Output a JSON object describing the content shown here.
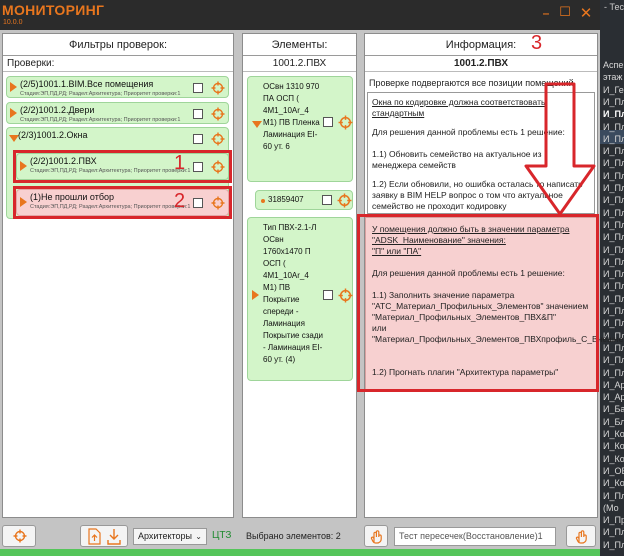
{
  "window": {
    "title": "МОНИТОРИНГ",
    "version": "10.0.0",
    "minimize_glyph": "–",
    "maximize_glyph": "☐",
    "close_glyph": "✕"
  },
  "colors": {
    "accent": "#e8761e",
    "ok": "#d3f5c9",
    "error": "#f8d0d0",
    "annotation": "#d8262b",
    "status": "#55c55a"
  },
  "bg_editor": {
    "tab_text": "- Тест",
    "rows": [
      {
        "text": "Аспект",
        "bold": false
      },
      {
        "text": "этаж",
        "bold": false
      },
      {
        "text": "И_Ген",
        "bold": false
      },
      {
        "text": "И_Пл",
        "bold": false
      },
      {
        "text": "И_Пл",
        "bold": true
      },
      {
        "text": "И_Пл",
        "bold": false
      },
      {
        "text": "И_Пл",
        "bold": false
      },
      {
        "text": "И_Пл",
        "bold": false
      },
      {
        "text": "И_Пл",
        "bold": false
      },
      {
        "text": "И_Пл",
        "bold": false
      },
      {
        "text": "И_Пл",
        "bold": false
      },
      {
        "text": "И_Пл",
        "bold": false
      },
      {
        "text": "И_Пл",
        "bold": false
      },
      {
        "text": "И_Пл",
        "bold": false
      },
      {
        "text": "И_Пл",
        "bold": false
      },
      {
        "text": "И_Пл",
        "bold": false
      },
      {
        "text": "И_Пл",
        "bold": false
      },
      {
        "text": "И_Пл",
        "bold": false
      },
      {
        "text": "И_Пл",
        "bold": false
      },
      {
        "text": "И_Пл",
        "bold": false
      },
      {
        "text": "И_Пл",
        "bold": false
      },
      {
        "text": "И_Пл",
        "bold": false
      },
      {
        "text": "И_Пл",
        "bold": false
      },
      {
        "text": "И_Пл",
        "bold": false
      },
      {
        "text": "И_Пл",
        "bold": false
      },
      {
        "text": "И_Пл",
        "bold": false
      },
      {
        "text": "И_Ар",
        "bold": false
      },
      {
        "text": "И_Ар",
        "bold": false
      },
      {
        "text": "И_Ба",
        "bold": false
      },
      {
        "text": "И_Бл",
        "bold": false
      },
      {
        "text": "И_Ко",
        "bold": false
      },
      {
        "text": "И_Ко",
        "bold": false
      },
      {
        "text": "И_Ко",
        "bold": false
      },
      {
        "text": "И_ОВ",
        "bold": false
      },
      {
        "text": "И_Ко",
        "bold": false
      },
      {
        "text": "И_Пл",
        "bold": false
      },
      {
        "text": "(Мо",
        "bold": false
      },
      {
        "text": "И_Пр",
        "bold": false
      },
      {
        "text": "И_Пл",
        "bold": false
      },
      {
        "text": "И_Пл",
        "bold": false
      }
    ]
  },
  "filters": {
    "header": "Фильтры проверок:",
    "subheader": "Проверки:",
    "items": [
      {
        "title": "(2/5)1001.1.BIM.Все помещения",
        "meta": "Стадия:ЭП,ПД,РД; Раздел:Архитектура; Приоритет проверки:1",
        "state": "ok",
        "expanded": false
      },
      {
        "title": "(2/2)1001.2.Двери",
        "meta": "Стадия:ЭП,ПД,РД; Раздел:Архитектура; Приоритет проверки:1",
        "state": "ok",
        "expanded": false
      },
      {
        "title": "(2/3)1001.2.Окна",
        "meta": "",
        "state": "ok",
        "expanded": true
      },
      {
        "title": "(2/2)1001.2.ПВХ",
        "meta": "Стадия:ЭП,ПД,РД; Раздел:Архитектура; Приоритет проверки:1",
        "state": "ok",
        "expanded": false
      },
      {
        "title": "(1)Не прошли отбор",
        "meta": "Стадия:ЭП,ПД,РД; Раздел:Архитектура; Приоритет проверки:1",
        "state": "error",
        "expanded": false
      }
    ]
  },
  "elements": {
    "header": "Элементы:",
    "subheader": "1001.2.ПВХ",
    "items": [
      {
        "text": "ОСвн 1310 970 ПА ОСП ( 4М1_10Ar_4 М1) ПВ Пленка Ламинация EI-60 ут. 6"
      },
      {
        "text": "31859407"
      },
      {
        "text": "Тип ПВХ-2.1-Л ОСвн 1760x1470 П ОСП ( 4М1_10Ar_4 М1) ПВ Покрытие спереди - Ламинация Покрытие сзади - Ламинация EI-60 ут. (4)"
      }
    ]
  },
  "info": {
    "header": "Информация:",
    "subheader": "1001.2.ПВХ",
    "intro": "Проверке подвергаются все позиции помещений",
    "box": {
      "line1": "Окна по кодировке должна соответствовать стандартным",
      "line2": "Для решения данной проблемы есть 1 решение:",
      "line3": "1.1) Обновить семейство на актуальное из менеджера семейств",
      "line4": "1.2) Если обновили, но ошибка осталась то написать заявку в BIM HELP вопрос о том что актуальное семейство не проходит кодировку"
    },
    "warning": {
      "line1": "У помещения должно быть в значении параметра \"ADSK_Наименование\" значения:",
      "line2": "\"П\" или \"ПА\"",
      "line3": "Для решения данной проблемы есть 1 решение:",
      "line4": "1.1) Заполнить значение параметра \"АТС_Материал_Профильных_Элементов\" значением \"Материал_Профильных_Элементов_ПВХ&П\"",
      "line5": "или",
      "line6": "\"Материал_Профильных_Элементов_ПВХпрофиль_С_Внешней_Алюминиевой_Накладкой&ПА\"",
      "line7": "1.2) Прогнать плагин \"Архитектура параметры\""
    }
  },
  "toolbar": {
    "discipline": "Архитекторы",
    "discipline_caret": "⌄",
    "cts_label": "ЦТЗ",
    "selected_label": "Выбрано элементов: 2",
    "search_placeholder": "Тест пересечек(Восстановление)1"
  },
  "annotations": {
    "n1": "1",
    "n2": "2",
    "n3": "3"
  }
}
